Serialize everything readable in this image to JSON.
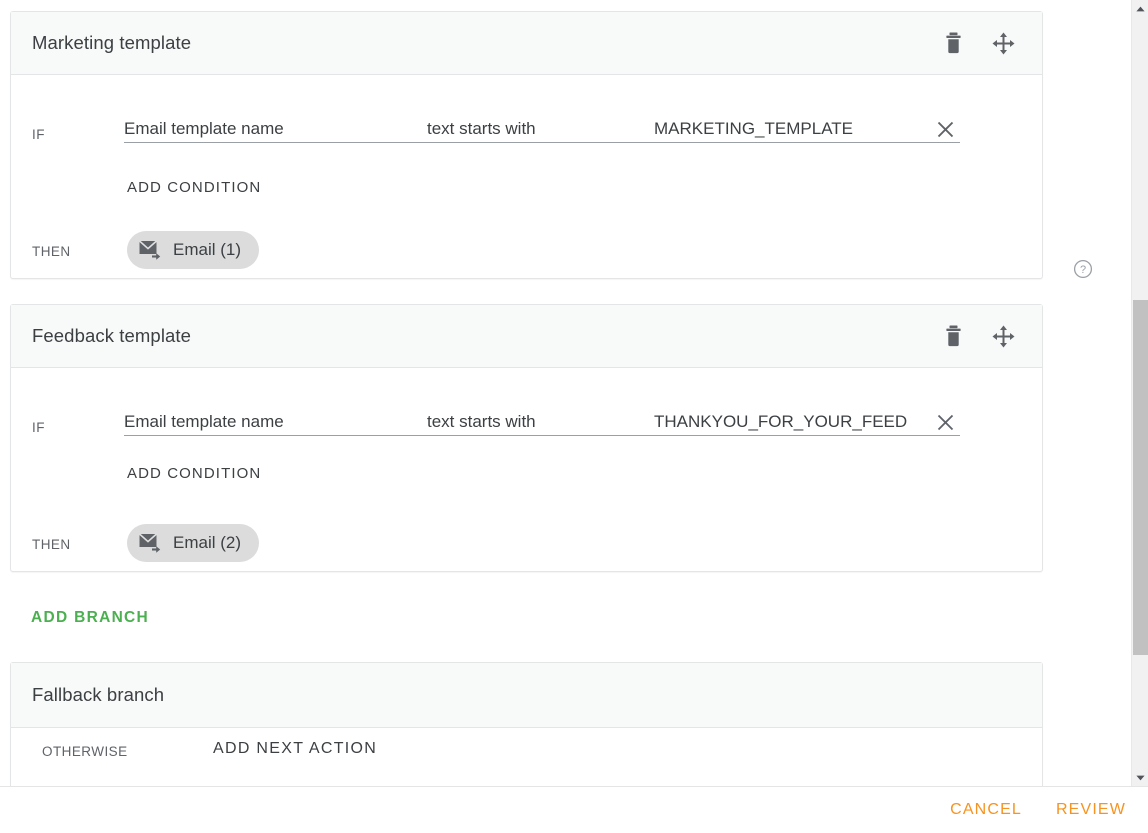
{
  "branches": [
    {
      "title": "Marketing template",
      "if_label": "IF",
      "then_label": "THEN",
      "condition": {
        "attribute": "Email template name",
        "operator": "text starts with",
        "value": "MARKETING_TEMPLATE",
        "clear_icon": "close-icon"
      },
      "add_condition_label": "ADD CONDITION",
      "action_chip": {
        "label": "Email (1)",
        "icon": "email-forward-icon"
      },
      "delete_icon": "trash-icon",
      "move_icon": "move-handle-icon"
    },
    {
      "title": "Feedback template",
      "if_label": "IF",
      "then_label": "THEN",
      "condition": {
        "attribute": "Email template name",
        "operator": "text starts with",
        "value": "THANKYOU_FOR_YOUR_FEED",
        "clear_icon": "close-icon"
      },
      "add_condition_label": "ADD CONDITION",
      "action_chip": {
        "label": "Email (2)",
        "icon": "email-forward-icon"
      },
      "delete_icon": "trash-icon",
      "move_icon": "move-handle-icon"
    }
  ],
  "add_branch": {
    "label": "ADD BRANCH",
    "color": "#4CAF50"
  },
  "fallback": {
    "title": "Fallback branch",
    "otherwise_label": "OTHERWISE",
    "add_next_action_label": "ADD NEXT ACTION"
  },
  "help": {
    "icon": "help-circle-icon"
  },
  "bottom_bar": {
    "cancel_label": "CANCEL",
    "review_label": "REVIEW",
    "accent_color": "#F79320"
  },
  "scrollbar": {
    "up_icon": "caret-up-icon",
    "down_icon": "caret-down-icon"
  }
}
